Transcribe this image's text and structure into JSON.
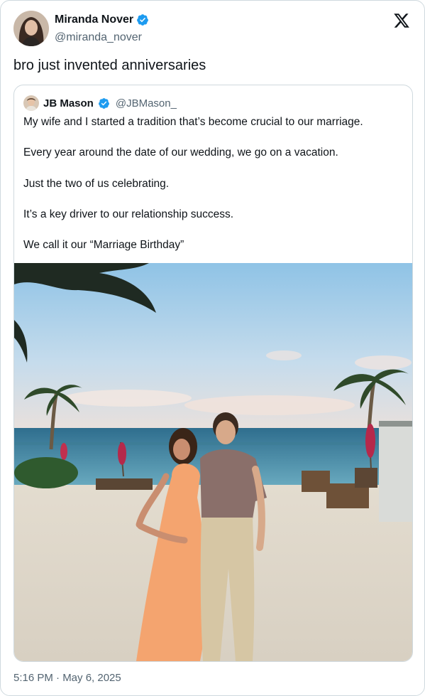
{
  "tweet": {
    "author": {
      "name": "Miranda Nover",
      "handle": "@miranda_nover",
      "verified": true,
      "avatar_icon": "profile-photo-icon"
    },
    "text": "bro just invented anniversaries",
    "timestamp": "5:16 PM · May 6, 2025",
    "platform_icon": "x-logo-icon"
  },
  "quoted": {
    "author": {
      "name": "JB Mason",
      "handle": "@JBMason_",
      "verified": true,
      "avatar_icon": "profile-photo-icon"
    },
    "lines": [
      "My wife and I started a tradition that’s become crucial to our marriage.",
      "Every year around the date of our wedding, we go on a vacation.",
      "Just the two of us celebrating.",
      "It’s a key driver to our relationship success.",
      "We call it our “Marriage Birthday”"
    ],
    "media": "beach-couple-photo"
  },
  "colors": {
    "text": "#0f1419",
    "secondary": "#536471",
    "verified": "#1d9bf0",
    "border": "#cfd9de"
  }
}
